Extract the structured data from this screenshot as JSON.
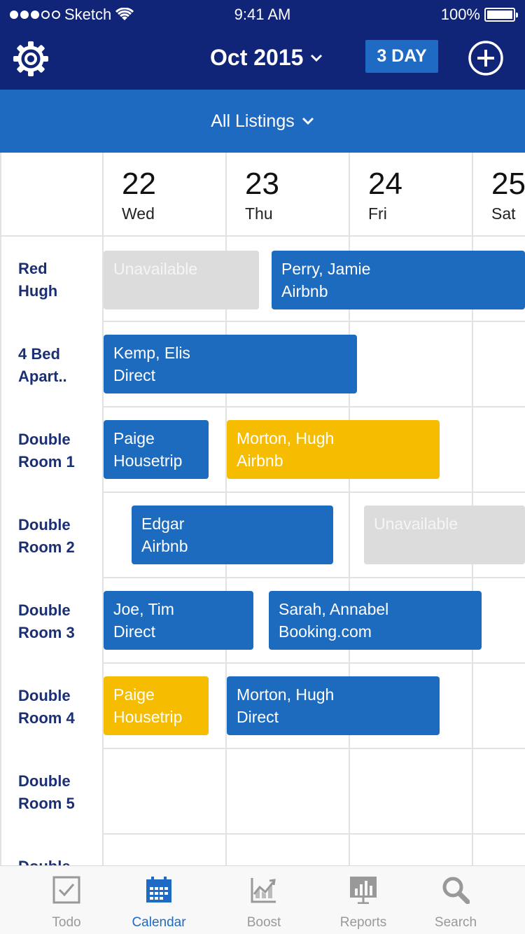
{
  "status": {
    "carrier": "Sketch",
    "time": "9:41 AM",
    "battery": "100%"
  },
  "header": {
    "month": "Oct 2015",
    "view": "3 DAY"
  },
  "filter": {
    "label": "All Listings"
  },
  "days": [
    {
      "num": "22",
      "dow": "Wed"
    },
    {
      "num": "23",
      "dow": "Thu"
    },
    {
      "num": "24",
      "dow": "Fri"
    },
    {
      "num": "25",
      "dow": "Sat"
    }
  ],
  "rooms": [
    {
      "line1": "Red",
      "line2": "Hugh"
    },
    {
      "line1": "4 Bed",
      "line2": "Apart.."
    },
    {
      "line1": "Double",
      "line2": "Room 1"
    },
    {
      "line1": "Double",
      "line2": "Room 2"
    },
    {
      "line1": "Double",
      "line2": "Room 3"
    },
    {
      "line1": "Double",
      "line2": "Room 4"
    },
    {
      "line1": "Double",
      "line2": "Room 5"
    },
    {
      "line1": "Double",
      "line2": ""
    }
  ],
  "bookings": [
    {
      "name": "Unavailable",
      "source": "",
      "color": "gray"
    },
    {
      "name": "Perry, Jamie",
      "source": "Airbnb",
      "color": "blue"
    },
    {
      "name": "Kemp, Elis",
      "source": "Direct",
      "color": "blue"
    },
    {
      "name": "Paige",
      "source": "Housetrip",
      "color": "blue"
    },
    {
      "name": "Morton, Hugh",
      "source": "Airbnb",
      "color": "yellow"
    },
    {
      "name": "Edgar",
      "source": "Airbnb",
      "color": "blue"
    },
    {
      "name": "Unavailable",
      "source": "",
      "color": "gray"
    },
    {
      "name": "Joe, Tim",
      "source": "Direct",
      "color": "blue"
    },
    {
      "name": "Sarah, Annabel",
      "source": "Booking.com",
      "color": "blue"
    },
    {
      "name": "Paige",
      "source": "Housetrip",
      "color": "yellow"
    },
    {
      "name": "Morton, Hugh",
      "source": "Direct",
      "color": "blue"
    }
  ],
  "tabs": [
    {
      "label": "Todo",
      "icon": "todo-icon"
    },
    {
      "label": "Calendar",
      "icon": "calendar-icon",
      "active": true
    },
    {
      "label": "Boost",
      "icon": "boost-icon"
    },
    {
      "label": "Reports",
      "icon": "reports-icon"
    },
    {
      "label": "Search",
      "icon": "search-icon"
    }
  ],
  "colors": {
    "nav": "#102478",
    "accent": "#1e6ac1",
    "booking_blue": "#1d6bbf",
    "booking_yellow": "#f5bc00",
    "unavailable": "#dcdcdc"
  }
}
